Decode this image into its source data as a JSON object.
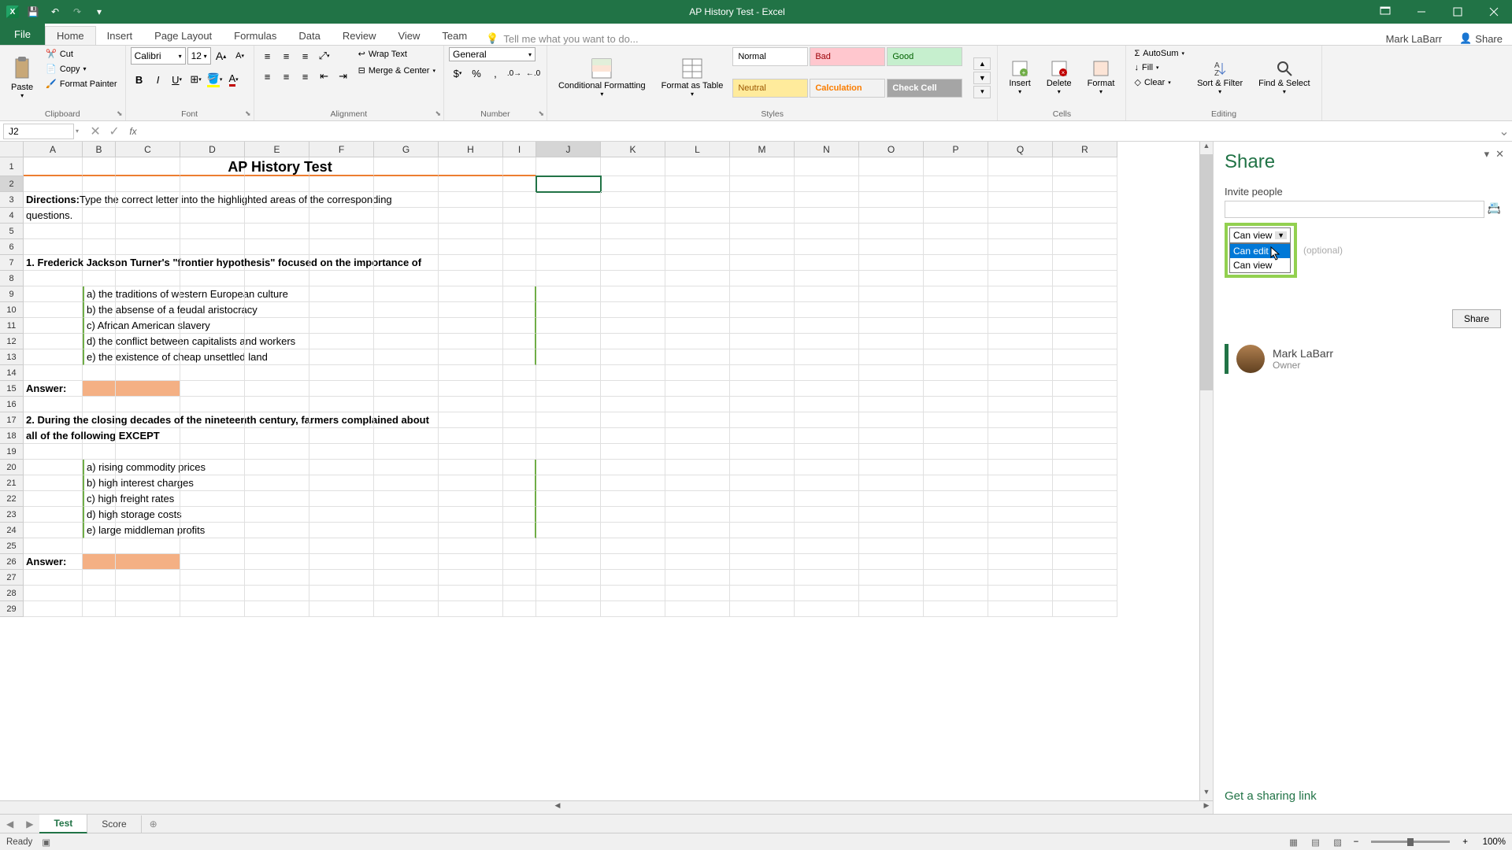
{
  "app": {
    "title": "AP History Test - Excel",
    "user": "Mark LaBarr",
    "share_label": "Share"
  },
  "tabs": {
    "file": "File",
    "list": [
      "Home",
      "Insert",
      "Page Layout",
      "Formulas",
      "Data",
      "Review",
      "View",
      "Team"
    ],
    "active": "Home",
    "tell_me": "Tell me what you want to do..."
  },
  "ribbon": {
    "clipboard": {
      "label": "Clipboard",
      "paste": "Paste",
      "cut": "Cut",
      "copy": "Copy",
      "painter": "Format Painter"
    },
    "font": {
      "label": "Font",
      "name": "Calibri",
      "size": "12"
    },
    "alignment": {
      "label": "Alignment",
      "wrap": "Wrap Text",
      "merge": "Merge & Center"
    },
    "number": {
      "label": "Number",
      "format": "General"
    },
    "styles": {
      "label": "Styles",
      "conditional": "Conditional Formatting",
      "format_as": "Format as Table",
      "normal": "Normal",
      "bad": "Bad",
      "good": "Good",
      "neutral": "Neutral",
      "calculation": "Calculation",
      "check": "Check Cell"
    },
    "cells": {
      "label": "Cells",
      "insert": "Insert",
      "delete": "Delete",
      "format": "Format"
    },
    "editing": {
      "label": "Editing",
      "autosum": "AutoSum",
      "fill": "Fill",
      "clear": "Clear",
      "sort": "Sort & Filter",
      "find": "Find & Select"
    }
  },
  "formula": {
    "name_box": "J2"
  },
  "columns": [
    "A",
    "B",
    "C",
    "D",
    "E",
    "F",
    "G",
    "H",
    "I",
    "J",
    "K",
    "L",
    "M",
    "N",
    "O",
    "P",
    "Q",
    "R"
  ],
  "rows": 29,
  "selected": {
    "col": "J",
    "row": 2
  },
  "content": {
    "title": "AP History Test",
    "directions_bold": "Directions:",
    "directions_1": " Type the correct letter into the highlighted areas of the corresponding",
    "directions_2": "questions.",
    "q1": "1. Frederick Jackson Turner's \"frontier hypothesis\" focused on the importance of",
    "q1a": "a) the traditions of western European culture",
    "q1b": "b) the absense of a feudal aristocracy",
    "q1c": "c) African American slavery",
    "q1d": "d) the conflict between capitalists and workers",
    "q1e": "e) the existence of cheap unsettled land",
    "answer_label": "Answer:",
    "q2a_line": "2. During the closing decades of the nineteenth century, farmers complained about",
    "q2b_line": "all of the following EXCEPT",
    "q2_a": "a) rising commodity prices",
    "q2_b": "b) high interest charges",
    "q2_c": "c) high freight rates",
    "q2_d": "d) high storage costs",
    "q2_e": "e) large middleman profits"
  },
  "share": {
    "title": "Share",
    "invite": "Invite people",
    "perm_current": "Can view",
    "perm_options": [
      "Can edit",
      "Can view"
    ],
    "msg_hint": "(optional)",
    "share_btn": "Share",
    "owner_name": "Mark LaBarr",
    "owner_role": "Owner",
    "link": "Get a sharing link"
  },
  "sheets": {
    "tabs": [
      "Test",
      "Score"
    ],
    "active": "Test"
  },
  "status": {
    "ready": "Ready",
    "zoom": "100%"
  }
}
